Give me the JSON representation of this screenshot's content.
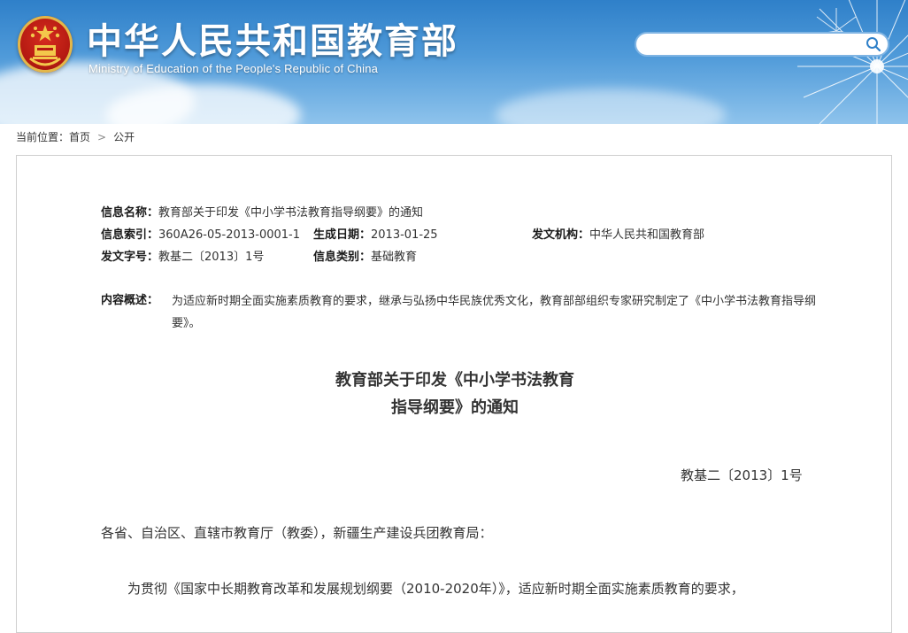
{
  "header": {
    "site_title": "中华人民共和国教育部",
    "site_subtitle": "Ministry of Education of the People's Republic of China",
    "search_placeholder": ""
  },
  "breadcrumb": {
    "label": "当前位置：",
    "items": [
      "首页",
      "公开"
    ],
    "separator": ">"
  },
  "info": {
    "name_label": "信息名称：",
    "name_value": "教育部关于印发《中小学书法教育指导纲要》的通知",
    "index_label": "信息索引：",
    "index_value": "360A26-05-2013-0001-1",
    "date_label": "生成日期：",
    "date_value": "2013-01-25",
    "agency_label": "发文机构：",
    "agency_value": "中华人民共和国教育部",
    "docno_label": "发文字号：",
    "docno_value": "教基二〔2013〕1号",
    "category_label": "信息类别：",
    "category_value": "基础教育",
    "summary_label": "内容概述：",
    "summary_value": "为适应新时期全面实施素质教育的要求，继承与弘扬中华民族优秀文化，教育部部组织专家研究制定了《中小学书法教育指导纲要》。"
  },
  "document": {
    "title_line1": "教育部关于印发《中小学书法教育",
    "title_line2": "指导纲要》的通知",
    "number": "教基二〔2013〕1号",
    "salutation": "各省、自治区、直辖市教育厅（教委），新疆生产建设兵团教育局：",
    "para1": "为贯彻《国家中长期教育改革和发展规划纲要（2010-2020年）》，适应新时期全面实施素质教育的要求，"
  },
  "colors": {
    "header_blue": "#2f80c9",
    "emblem_red": "#b51a12",
    "emblem_gold": "#e3b84a",
    "text": "#333333"
  }
}
